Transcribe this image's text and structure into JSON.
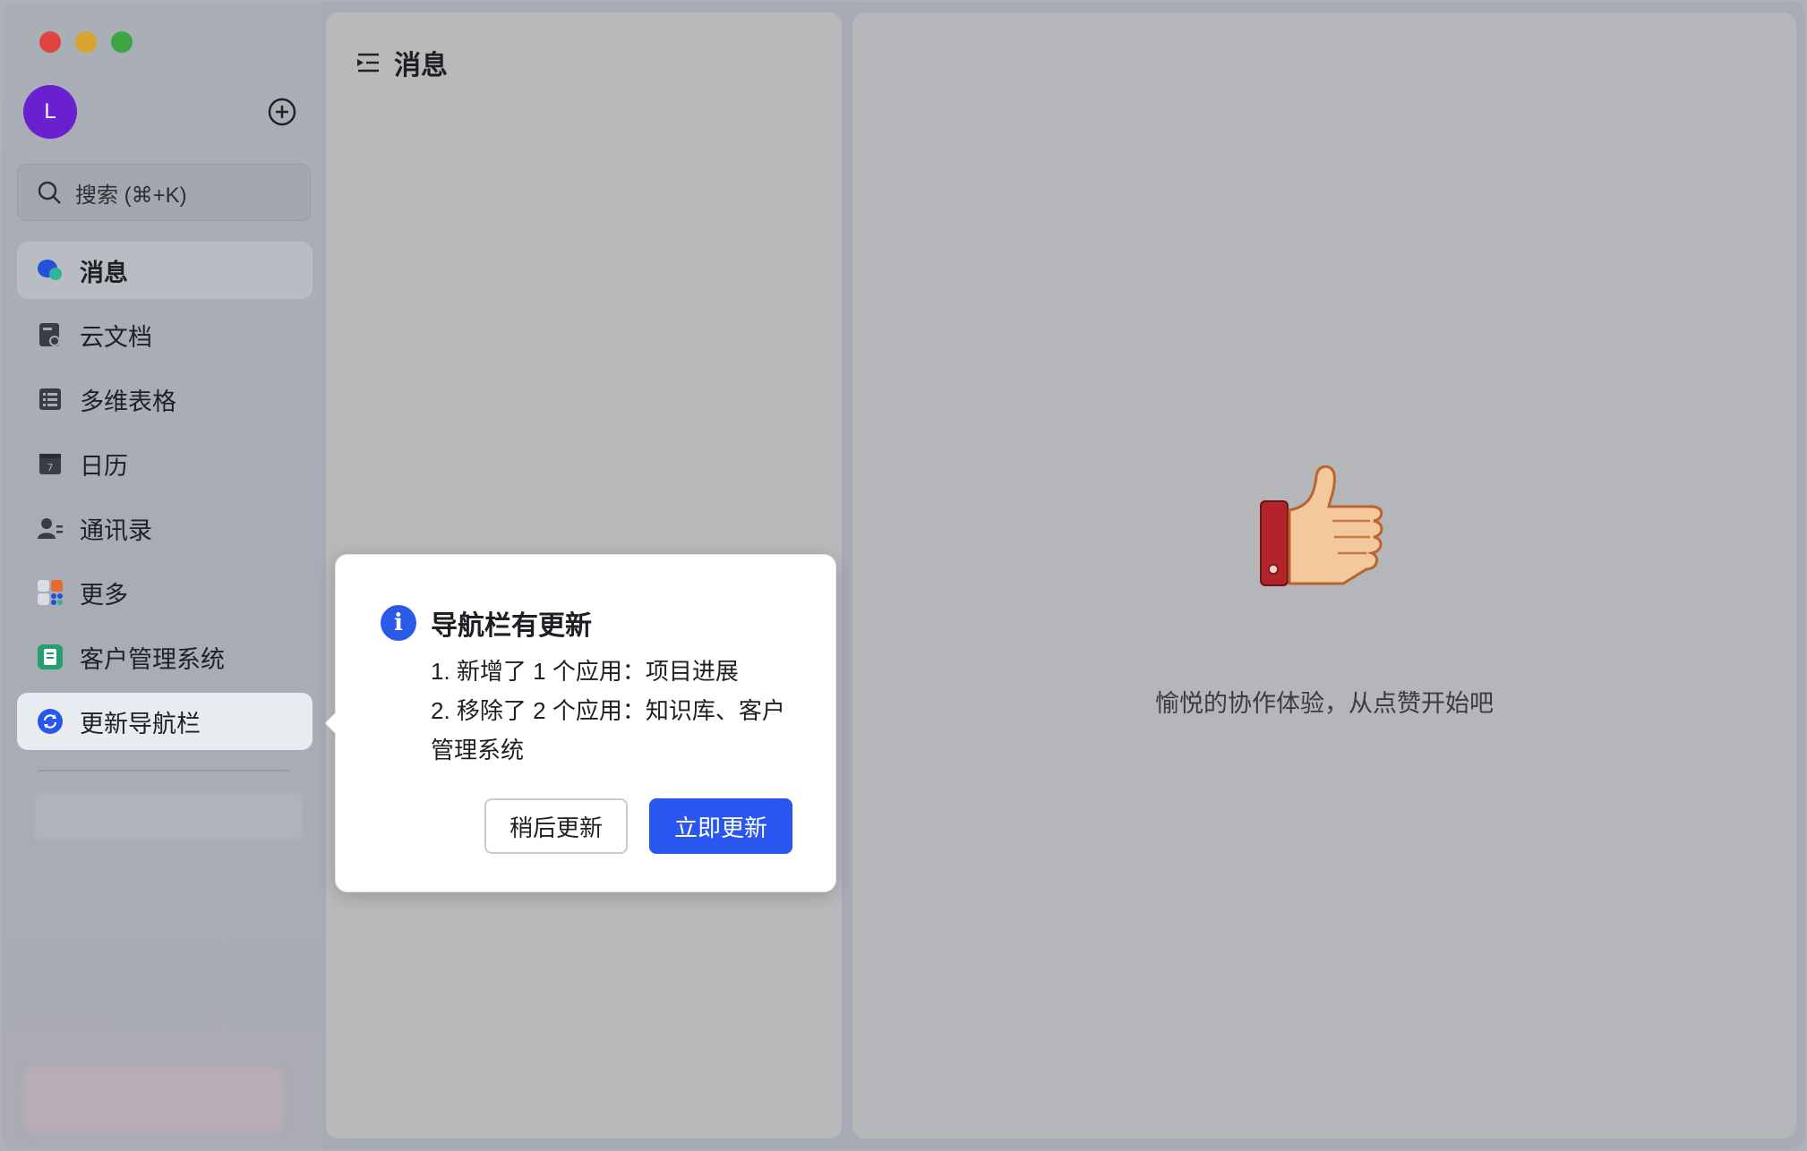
{
  "sidebar": {
    "avatar_letter": "L",
    "search_placeholder": "搜索 (⌘+K)",
    "items": [
      {
        "label": "消息",
        "icon": "chat-bubbles-icon"
      },
      {
        "label": "云文档",
        "icon": "cloud-doc-icon"
      },
      {
        "label": "多维表格",
        "icon": "table-icon"
      },
      {
        "label": "日历",
        "icon": "calendar-icon"
      },
      {
        "label": "通讯录",
        "icon": "contacts-icon"
      },
      {
        "label": "更多",
        "icon": "apps-grid-icon"
      },
      {
        "label": "客户管理系统",
        "icon": "crm-app-icon"
      },
      {
        "label": "更新导航栏",
        "icon": "refresh-icon"
      }
    ]
  },
  "middle": {
    "title": "消息"
  },
  "right": {
    "empty_text": "愉悦的协作体验，从点赞开始吧"
  },
  "popover": {
    "title": "导航栏有更新",
    "line1": "1. 新增了 1 个应用：项目进展",
    "line2": "2. 移除了 2 个应用：知识库、客户管理系统",
    "later_button": "稍后更新",
    "now_button": "立即更新"
  },
  "colors": {
    "accent": "#2a56f0",
    "avatar": "#6a1fd0"
  }
}
